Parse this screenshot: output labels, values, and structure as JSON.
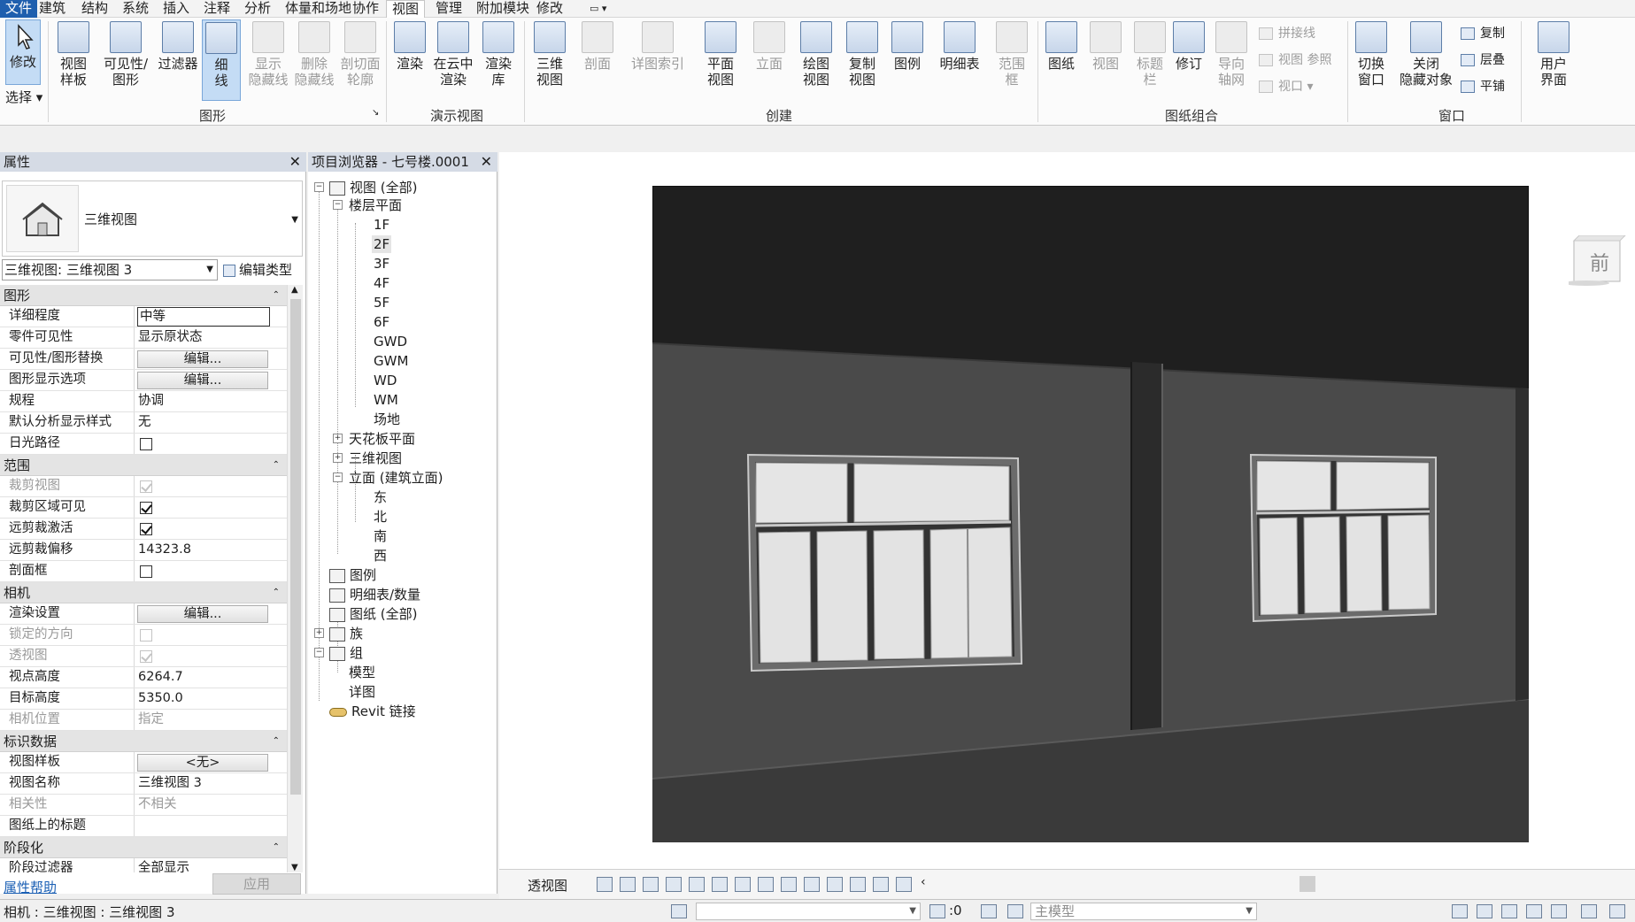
{
  "tabs": [
    "文件",
    "建筑",
    "结构",
    "系统",
    "插入",
    "注释",
    "分析",
    "体量和场地",
    "协作",
    "视图",
    "管理",
    "附加模块",
    "修改"
  ],
  "active_tab": "视图",
  "ribbon": {
    "select_label": "选择",
    "modify": "修改",
    "graphics": {
      "view_template": "视图\n样板",
      "vis_graphics": "可见性/\n图形",
      "filters": "过滤器",
      "thin_lines": "细\n线",
      "show_hidden": "显示\n隐藏线",
      "remove_hidden": "删除\n隐藏线",
      "cut_profile": "剖切面\n轮廓",
      "label": "图形"
    },
    "presentation": {
      "render": "渲染",
      "cloud_render": "在云中\n渲染",
      "render_gallery": "渲染\n库",
      "label": "演示视图"
    },
    "create": {
      "three_d": "三维\n视图",
      "section": "剖面",
      "callout": "详图索引",
      "plan": "平面\n视图",
      "elevation": "立面",
      "drafting": "绘图\n视图",
      "duplicate": "复制\n视图",
      "legend": "图例",
      "schedules": "明细表",
      "scope_box": "范围\n框",
      "label": "创建"
    },
    "sheet": {
      "sheet": "图纸",
      "view": "视图",
      "title_block": "标题\n栏",
      "revisions": "修订",
      "guide_grid": "导向\n轴网",
      "matchline": "拼接线",
      "view_ref": "视图 参照",
      "viewports": "视口",
      "label": "图纸组合"
    },
    "windows": {
      "switch": "切换\n窗口",
      "close_hidden": "关闭\n隐藏对象",
      "replicate": "复制",
      "cascade": "层叠",
      "tile": "平铺",
      "label": "窗口"
    },
    "ui": {
      "user_interface": "用户\n界面"
    }
  },
  "properties": {
    "title": "属性",
    "type_name": "三维视图",
    "instance": "三维视图: 三维视图 3",
    "edit_type": "编辑类型",
    "sections": [
      {
        "name": "图形",
        "rows": [
          {
            "k": "详细程度",
            "v": "中等",
            "kind": "input"
          },
          {
            "k": "零件可见性",
            "v": "显示原状态",
            "kind": "text"
          },
          {
            "k": "可见性/图形替换",
            "v": "编辑...",
            "kind": "button"
          },
          {
            "k": "图形显示选项",
            "v": "编辑...",
            "kind": "button"
          },
          {
            "k": "规程",
            "v": "协调",
            "kind": "text"
          },
          {
            "k": "默认分析显示样式",
            "v": "无",
            "kind": "text"
          },
          {
            "k": "日光路径",
            "v": "",
            "kind": "check"
          }
        ]
      },
      {
        "name": "范围",
        "rows": [
          {
            "k": "裁剪视图",
            "v": "",
            "kind": "check-dim-on"
          },
          {
            "k": "裁剪区域可见",
            "v": "",
            "kind": "check-on"
          },
          {
            "k": "远剪裁激活",
            "v": "",
            "kind": "check-on"
          },
          {
            "k": "远剪裁偏移",
            "v": "14323.8",
            "kind": "text"
          },
          {
            "k": "剖面框",
            "v": "",
            "kind": "check"
          }
        ]
      },
      {
        "name": "相机",
        "rows": [
          {
            "k": "渲染设置",
            "v": "编辑...",
            "kind": "button"
          },
          {
            "k": "锁定的方向",
            "v": "",
            "kind": "check-dim"
          },
          {
            "k": "透视图",
            "v": "",
            "kind": "check-dim-on"
          },
          {
            "k": "视点高度",
            "v": "6264.7",
            "kind": "text"
          },
          {
            "k": "目标高度",
            "v": "5350.0",
            "kind": "text"
          },
          {
            "k": "相机位置",
            "v": "指定",
            "kind": "dim"
          }
        ]
      },
      {
        "name": "标识数据",
        "rows": [
          {
            "k": "视图样板",
            "v": "<无>",
            "kind": "button"
          },
          {
            "k": "视图名称",
            "v": "三维视图 3",
            "kind": "text"
          },
          {
            "k": "相关性",
            "v": "不相关",
            "kind": "dim"
          },
          {
            "k": "图纸上的标题",
            "v": "",
            "kind": "text"
          }
        ]
      },
      {
        "name": "阶段化",
        "rows": [
          {
            "k": "阶段过滤器",
            "v": "全部显示",
            "kind": "text"
          }
        ]
      }
    ],
    "help": "属性帮助",
    "apply": "应用"
  },
  "browser": {
    "title": "项目浏览器 - 七号楼.0001",
    "views_all": "视图 (全部)",
    "floor_plans": "楼层平面",
    "floors": [
      "1F",
      "2F",
      "3F",
      "4F",
      "5F",
      "6F",
      "GWD",
      "GWM",
      "WD",
      "WM",
      "场地"
    ],
    "ceiling_plans": "天花板平面",
    "three_d_views": "三维视图",
    "elevations": "立面 (建筑立面)",
    "elevation_items": [
      "东",
      "北",
      "南",
      "西"
    ],
    "legends": "图例",
    "schedules": "明细表/数量",
    "sheets": "图纸 (全部)",
    "families": "族",
    "groups": "组",
    "group_items": [
      "模型",
      "详图"
    ],
    "links": "Revit 链接"
  },
  "viewcube_label": "前",
  "view_bar": {
    "mode": "透视图"
  },
  "status": {
    "text": "相机 : 三维视图 : 三维视图 3",
    "coord": ":0",
    "model": "主模型"
  }
}
